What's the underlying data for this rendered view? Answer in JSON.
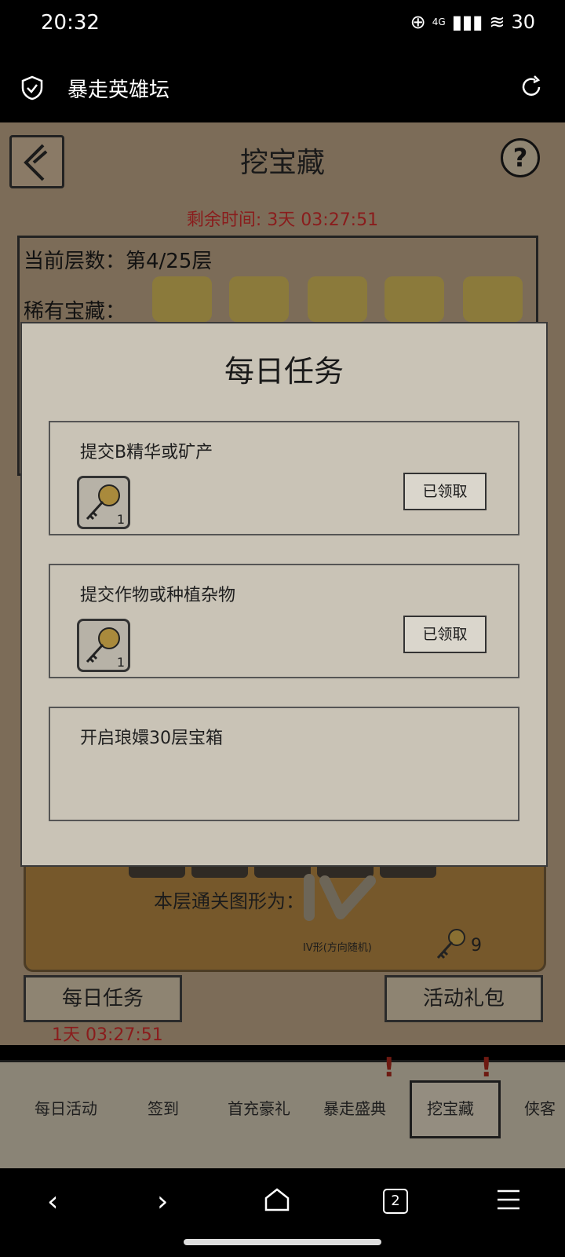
{
  "status_bar": {
    "time": "20:32",
    "network": "4G",
    "battery": "30"
  },
  "browser": {
    "title": "暴走英雄坛",
    "shield_icon": "shield-icon",
    "reload_icon": "reload-icon"
  },
  "game": {
    "title": "挖宝藏",
    "remaining_time": "剩余时间: 3天 03:27:51",
    "current_floor": "当前层数：第4/25层",
    "rare_treasure_label": "稀有宝藏：",
    "clear_shape_label": "本层通关图形为：",
    "shape_caption": "IV形(方向随机)",
    "key_count": "9",
    "daily_button": "每日任务",
    "daily_timer": "1天 03:27:51",
    "gift_button": "活动礼包"
  },
  "modal": {
    "title": "每日任务",
    "tasks": [
      {
        "label": "提交B精华或矿产",
        "reward_qty": "1",
        "button": "已领取"
      },
      {
        "label": "提交作物或种植杂物",
        "reward_qty": "1",
        "button": "已领取"
      },
      {
        "label": "开启琅嬛30层宝箱"
      }
    ]
  },
  "tabs": [
    {
      "label": "每日活动"
    },
    {
      "label": "签到"
    },
    {
      "label": "首充豪礼"
    },
    {
      "label": "暴走盛典"
    },
    {
      "label": "挖宝藏"
    },
    {
      "label": "侠客"
    }
  ],
  "nav": {
    "tab_count": "2"
  }
}
